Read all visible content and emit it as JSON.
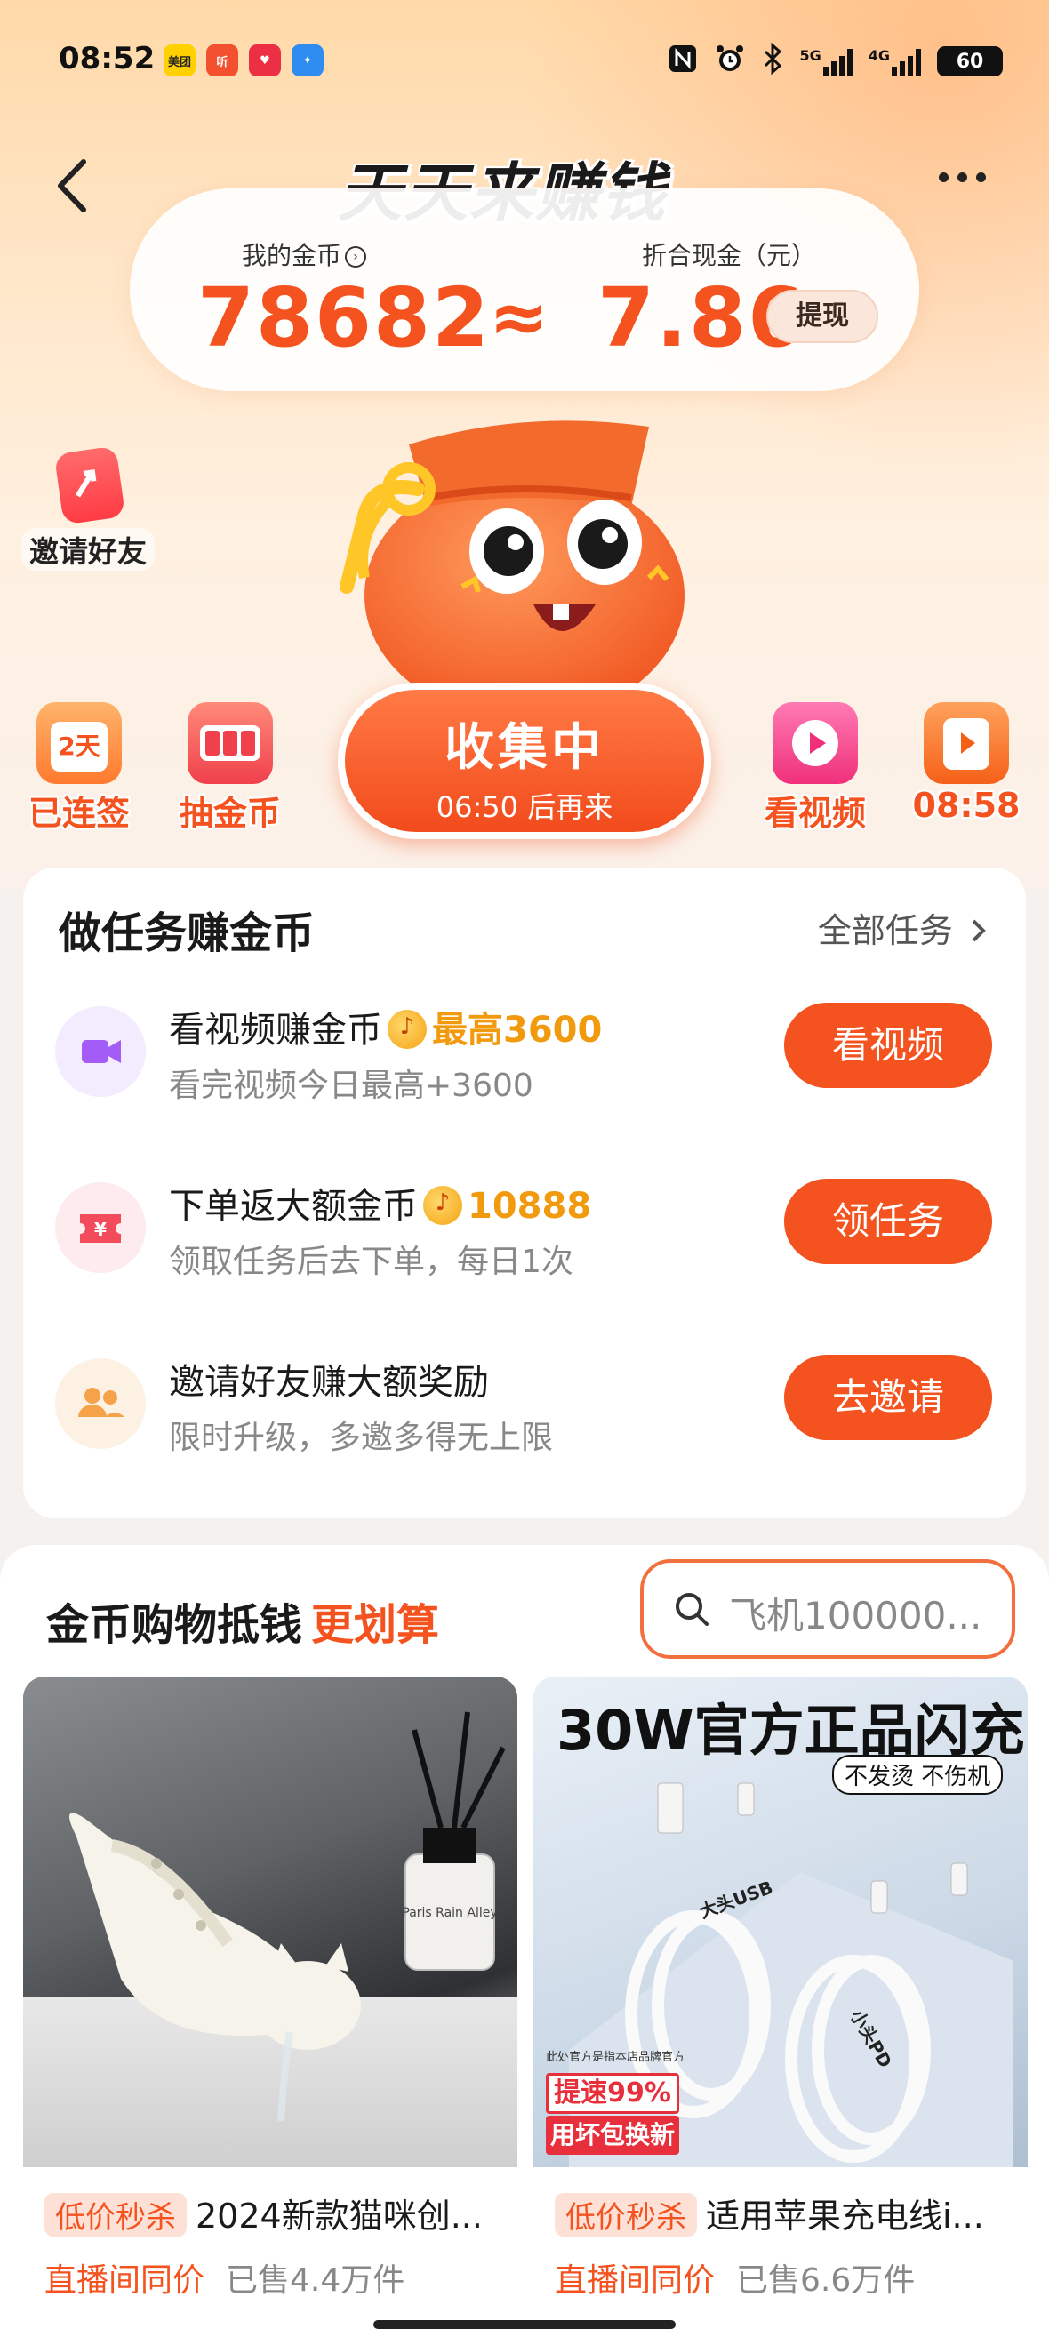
{
  "status_bar": {
    "time": "08:52",
    "apps": [
      {
        "name": "meituan-app-icon",
        "label": "美团",
        "color": "#ffd100",
        "text_color": "#222"
      },
      {
        "name": "listen-app-icon",
        "label": "听",
        "color": "#f2502e",
        "text_color": "#fff"
      },
      {
        "name": "health-app-icon",
        "label": "♥",
        "color": "#ec2f42",
        "text_color": "#fff"
      },
      {
        "name": "blue-app-icon",
        "label": "✦",
        "color": "#2f8df2",
        "text_color": "#fff"
      }
    ],
    "network_5g": "5G",
    "network_4g": "4G",
    "battery": "60"
  },
  "header": {
    "title": "天天来赚钱"
  },
  "coins": {
    "my_coins_label": "我的金币",
    "my_coins_value": "78682",
    "approx_symbol": "≈",
    "cash_label": "折合现金（元）",
    "cash_value": "7.86",
    "withdraw_label": "提现"
  },
  "side": {
    "invite_label": "邀请好友"
  },
  "quick_actions": {
    "checkin_badge": "2天",
    "checkin_label": "已连签",
    "lottery_label": "抽金币",
    "collect_title": "收集中",
    "collect_sub": "06:50 后再来",
    "video_label": "看视频",
    "timer_label": "08:58"
  },
  "tasks": {
    "title": "做任务赚金币",
    "all_label": "全部任务",
    "items": [
      {
        "name": "看视频赚金币",
        "reward": "最高3600",
        "desc": "看完视频今日最高+3600",
        "button": "看视频",
        "icon_bg": "#f3ecfe",
        "icon_color": "#a35cf5"
      },
      {
        "name": "下单返大额金币",
        "reward": "10888",
        "desc": "领取任务后去下单，每日1次",
        "button": "领任务",
        "icon_bg": "#fdebee",
        "icon_color": "#f24b5c"
      },
      {
        "name": "邀请好友赚大额奖励",
        "reward": "",
        "desc": "限时升级，多邀多得无上限",
        "button": "去邀请",
        "icon_bg": "#fdf1e4",
        "icon_color": "#f5a24a"
      }
    ]
  },
  "shop": {
    "title_main": "金币购物抵钱",
    "title_accent": "更划算",
    "search_placeholder": "飞机100000...",
    "products": [
      {
        "tag": "低价秒杀",
        "name": "2024新款猫咪创...",
        "live_price": "直播间同价",
        "sold": "已售4.4万件",
        "bottle_label": "Paris Rain Alley"
      },
      {
        "tag": "低价秒杀",
        "name": "适用苹果充电线i...",
        "live_price": "直播间同价",
        "sold": "已售6.6万件",
        "banner": "30W官方正品闪充",
        "sub_banner": "不发烫 不伤机",
        "cable1_label": "大头USB",
        "cable2_label": "小头PD",
        "fine_print": "此处官方是指本店品牌官方",
        "promo1": "提速99%",
        "promo2": "用坏包换新"
      }
    ]
  },
  "colors": {
    "accent": "#f4521e",
    "reward": "#f29a0e"
  }
}
